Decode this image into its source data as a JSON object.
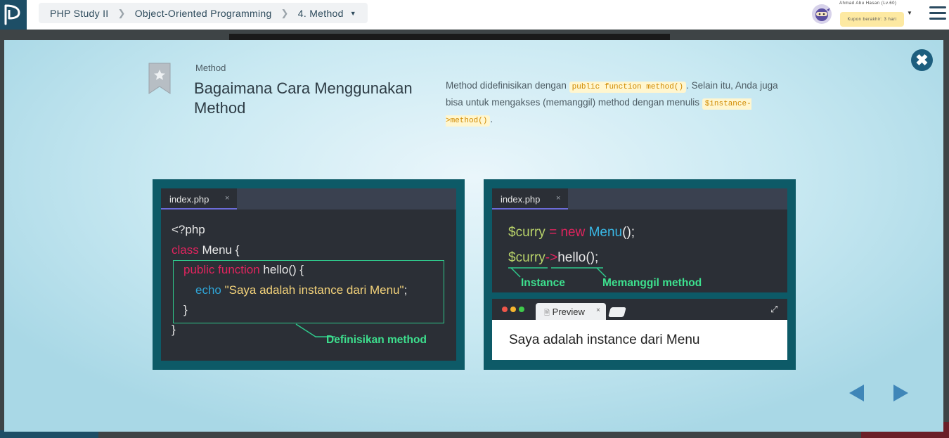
{
  "breadcrumb": {
    "course": "PHP Study II",
    "chapter": "Object-Oriented Programming",
    "lesson": "4. Method"
  },
  "user": {
    "name": "Ahmad Abu Hasan (Lv.60)",
    "coupon": "Kupon berakhir: 3 hari"
  },
  "slide": {
    "kicker": "Method",
    "title": "Bagaimana Cara Menggunakan Method",
    "desc_part1": "Method didefinisikan dengan ",
    "desc_code1": "public function method()",
    "desc_part2": ". Selain itu, Anda juga bisa untuk mengakses (memanggil) method dengan menulis ",
    "desc_code2": "$instance->method()",
    "desc_part3": "."
  },
  "left_panel": {
    "tab": "index.php",
    "tab_close": "×",
    "line1": "<?php",
    "line2_kw": "class",
    "line2_rest": " Menu {",
    "line3_kw": "public function",
    "line3_rest": " hello() {",
    "line4_kw": "echo",
    "line4_str": " \"Saya adalah instance dari Menu\"",
    "line4_end": ";",
    "line5": "}",
    "line6": "}",
    "annotation": "Definisikan method"
  },
  "right_panel": {
    "tab": "index.php",
    "tab_close": "×",
    "line1_var": "$curry",
    "line1_op": " = ",
    "line1_kw": "new",
    "line1_cls": " Menu",
    "line1_end": "();",
    "line2_var": "$curry",
    "line2_op": "->",
    "line2_rest": "hello();",
    "label_instance": "Instance",
    "label_call": "Memanggil method",
    "preview_tab": "Preview",
    "preview_close": "×",
    "preview_output": "Saya adalah instance dari Menu"
  },
  "colors": {
    "accent": "#1d5e7e",
    "highlight_green": "#3de08e",
    "keyword_pink": "#e0245e"
  }
}
